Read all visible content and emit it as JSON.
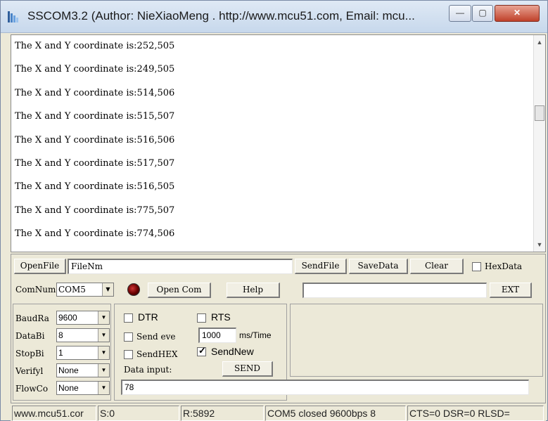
{
  "window": {
    "title": "SSCOM3.2 (Author: NieXiaoMeng . http://www.mcu51.com, Email: mcu...",
    "minimize_glyph": "—",
    "maximize_glyph": "▢",
    "close_glyph": "✕"
  },
  "output": {
    "lines": [
      "The X and Y coordinate is:252,505",
      "The X and Y coordinate is:249,505",
      "The X and Y coordinate is:514,506",
      "The X and Y coordinate is:515,507",
      "The X and Y coordinate is:516,506",
      "The X and Y coordinate is:517,507",
      "The X and Y coordinate is:516,505",
      "The X and Y coordinate is:775,507",
      "The X and Y coordinate is:774,506"
    ]
  },
  "toolbar": {
    "open_file": "OpenFile",
    "file_name": "FileNm",
    "send_file": "SendFile",
    "save_data": "SaveData",
    "clear": "Clear",
    "hex_data": "HexData",
    "com_num_label": "ComNum",
    "com_num_value": "COM5",
    "open_com": "Open Com",
    "help": "Help",
    "ext": "EXT"
  },
  "settings": {
    "baud_label": "BaudRa",
    "baud_value": "9600",
    "databits_label": "DataBi",
    "databits_value": "8",
    "stopbits_label": "StopBi",
    "stopbits_value": "1",
    "verify_label": "Verifyl",
    "verify_value": "None",
    "flow_label": "FlowCo",
    "flow_value": "None"
  },
  "options": {
    "dtr": "DTR",
    "rts": "RTS",
    "send_every": "Send eve",
    "interval_value": "1000",
    "interval_unit": "ms/Time",
    "send_hex": "SendHEX",
    "send_new": "SendNew",
    "send_new_checked": true,
    "data_input_label": "Data input:",
    "send": "SEND",
    "input_value": "78"
  },
  "status": {
    "site": "www.mcu51.cor",
    "sent": "S:0",
    "received": "R:5892",
    "port_state": "COM5 closed  9600bps  8",
    "lines": "CTS=0 DSR=0 RLSD="
  }
}
